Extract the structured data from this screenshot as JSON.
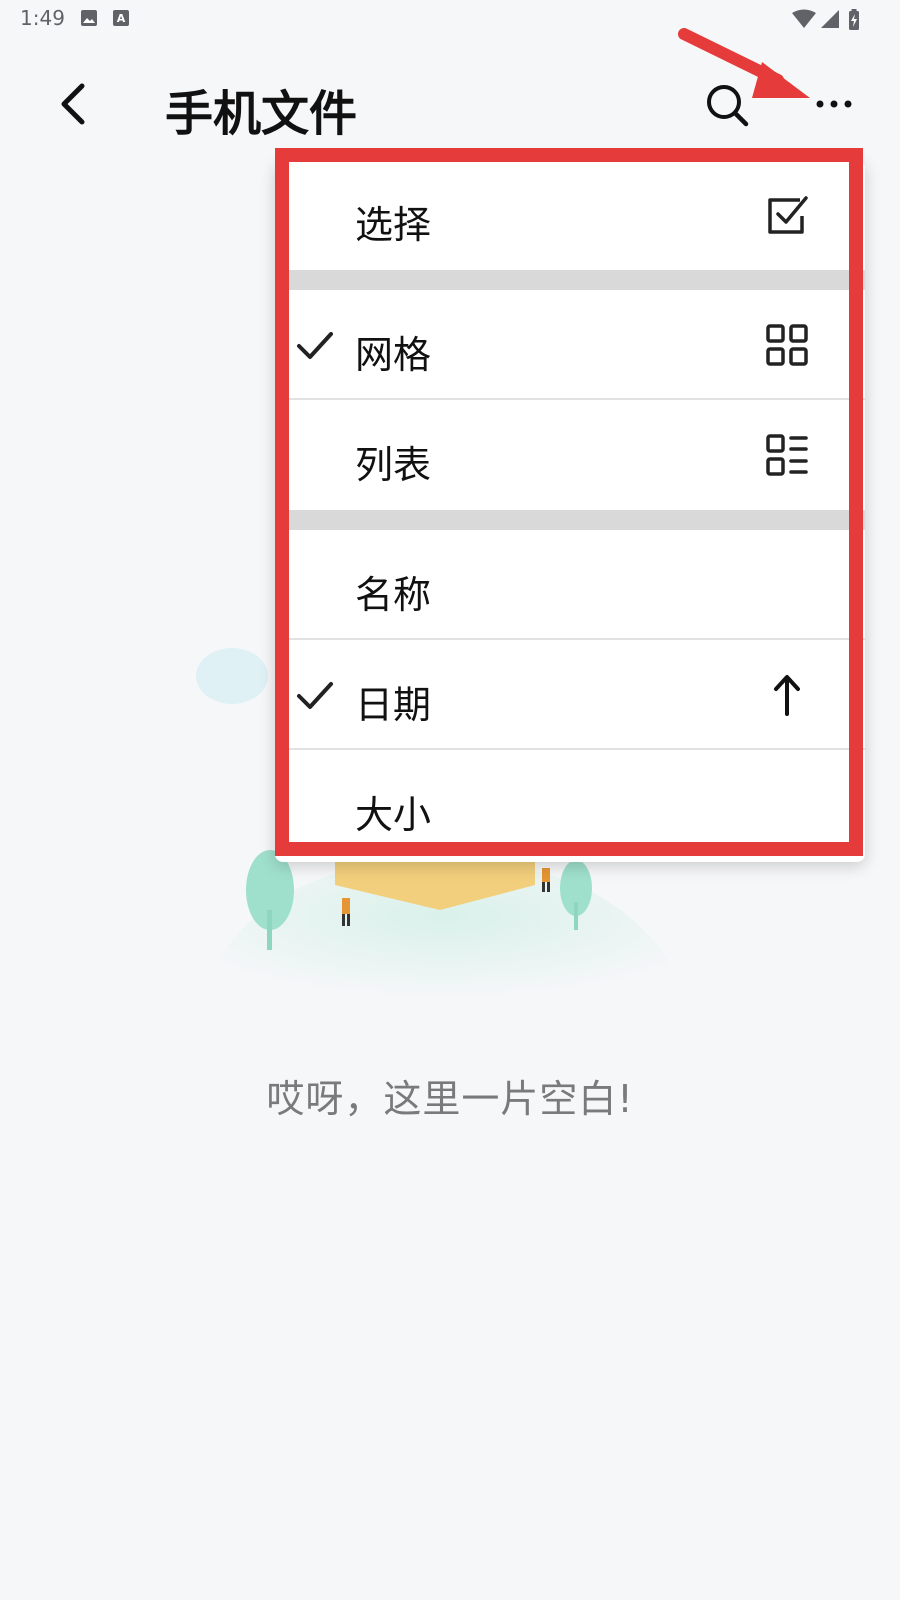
{
  "status_bar": {
    "time": "1:49",
    "icons": [
      "image-icon",
      "a-icon",
      "wifi-icon",
      "signal-icon",
      "battery-icon"
    ]
  },
  "app_bar": {
    "title": "手机文件",
    "icons": [
      "back-icon",
      "search-icon",
      "more-icon"
    ]
  },
  "menu": {
    "items": [
      {
        "label": "选择",
        "checked": false,
        "icon": "select-checkbox-icon"
      },
      {
        "label": "网格",
        "checked": true,
        "icon": "grid-icon"
      },
      {
        "label": "列表",
        "checked": false,
        "icon": "list-icon"
      },
      {
        "label": "名称",
        "checked": false
      },
      {
        "label": "日期",
        "checked": true,
        "icon": "arrow-up-icon"
      },
      {
        "label": "大小",
        "checked": false
      }
    ]
  },
  "empty_state": {
    "text": "哎呀，这里一片空白!"
  },
  "colors": {
    "highlight": "#e53b3b",
    "background": "#f6f7f9",
    "separator": "#d9d9d9"
  }
}
